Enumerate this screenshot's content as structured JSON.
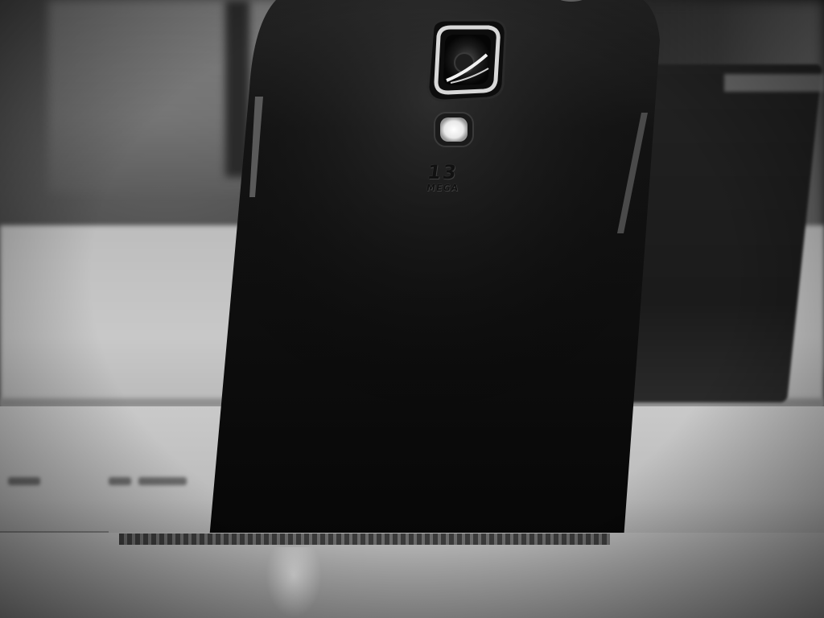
{
  "photo": {
    "subject": "phone-back-with-camera",
    "mode": "grayscale"
  },
  "phone": {
    "camera_label_number": "13",
    "camera_label_unit": "MEGA"
  }
}
